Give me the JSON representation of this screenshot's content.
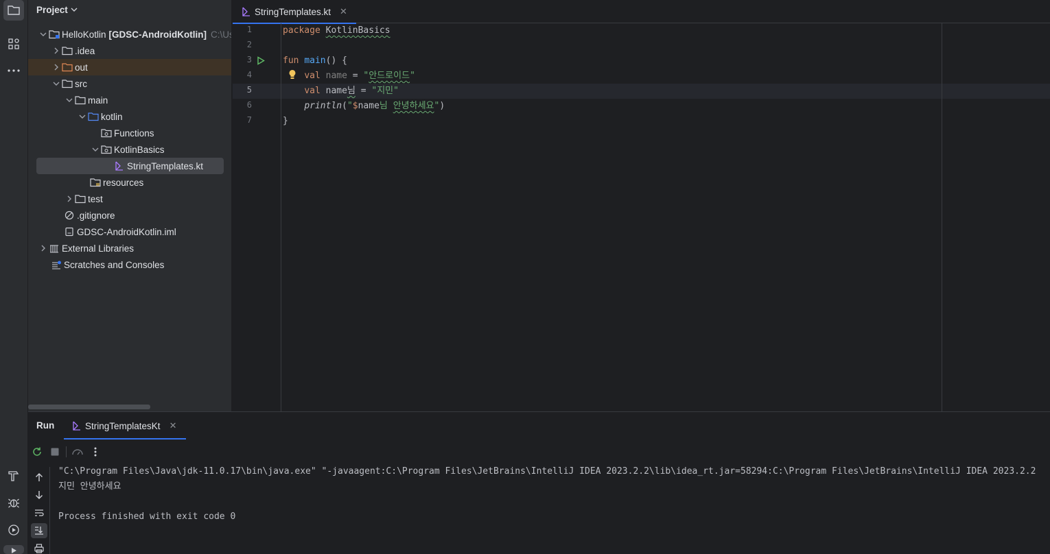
{
  "project_panel": {
    "title": "Project",
    "tree": [
      {
        "label": "HelloKotlin",
        "extra": "[GDSC-AndroidKotlin]",
        "path_hint": "C:\\Us",
        "icon": "module-folder-icon"
      },
      {
        "label": ".idea",
        "icon": "folder-icon"
      },
      {
        "label": "out",
        "icon": "excluded-folder-icon"
      },
      {
        "label": "src",
        "icon": "folder-icon"
      },
      {
        "label": "main",
        "icon": "folder-icon"
      },
      {
        "label": "kotlin",
        "icon": "source-folder-icon"
      },
      {
        "label": "Functions",
        "icon": "package-icon"
      },
      {
        "label": "KotlinBasics",
        "icon": "package-icon"
      },
      {
        "label": "StringTemplates.kt",
        "icon": "kotlin-file-icon"
      },
      {
        "label": "resources",
        "icon": "resources-folder-icon"
      },
      {
        "label": "test",
        "icon": "folder-icon"
      },
      {
        "label": ".gitignore",
        "icon": "ignore-file-icon"
      },
      {
        "label": "GDSC-AndroidKotlin.iml",
        "icon": "iml-file-icon"
      },
      {
        "label": "External Libraries",
        "icon": "library-icon"
      },
      {
        "label": "Scratches and Consoles",
        "icon": "scratches-icon"
      }
    ]
  },
  "editor": {
    "tab_label": "StringTemplates.kt",
    "line_numbers": [
      "1",
      "2",
      "3",
      "4",
      "5",
      "6",
      "7"
    ],
    "code": {
      "l1_kw": "package",
      "l1_pkg": "KotlinBasics",
      "l3_kw": "fun",
      "l3_fn": "main",
      "l3_rest": "() {",
      "l4_kw": "val",
      "l4_name": "name",
      "l4_eq": " = ",
      "l4_q1": "\"",
      "l4_str": "안드로이드",
      "l4_q2": "\"",
      "l5_kw": "val",
      "l5_name": "name",
      "l5_suffix": "님",
      "l5_eq": " = ",
      "l5_str": "\"지민\"",
      "l6_fn": "println",
      "l6_p1": "(",
      "l6_q1": "\"",
      "l6_dollar": "$",
      "l6_var": "name",
      "l6_txt1": "님 ",
      "l6_txt2": "안녕하세요",
      "l6_q2": "\"",
      "l6_p2": ")",
      "l7": "}"
    }
  },
  "run_panel": {
    "title": "Run",
    "tab_label": "StringTemplatesKt",
    "console": [
      "\"C:\\Program Files\\Java\\jdk-11.0.17\\bin\\java.exe\" \"-javaagent:C:\\Program Files\\JetBrains\\IntelliJ IDEA 2023.2.2\\lib\\idea_rt.jar=58294:C:\\Program Files\\JetBrains\\IntelliJ IDEA 2023.2.2",
      "지민 안녕하세요",
      "",
      "Process finished with exit code 0"
    ]
  },
  "colors": {
    "accent": "#3574f0",
    "keyword": "#cf8e6d",
    "function": "#56a8f5",
    "string": "#6aab73",
    "kotlin_icon": "#a97bff"
  }
}
